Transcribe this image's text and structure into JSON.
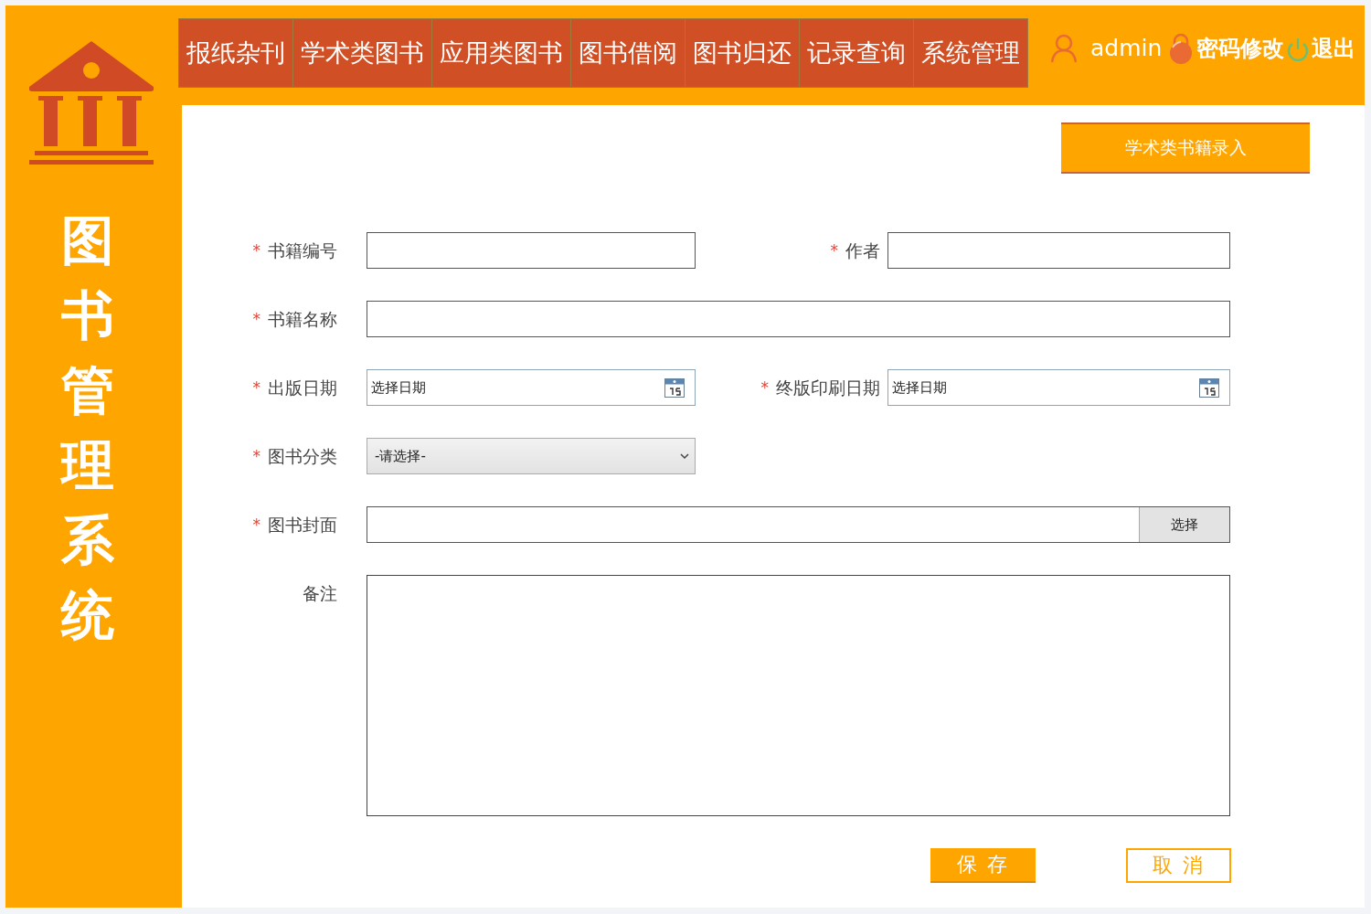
{
  "sidebar": {
    "title": "图书管理系统"
  },
  "nav": {
    "items": [
      {
        "label": "报纸杂刊"
      },
      {
        "label": "学术类图书"
      },
      {
        "label": "应用类图书"
      },
      {
        "label": "图书借阅"
      },
      {
        "label": "图书归还"
      },
      {
        "label": "记录查询"
      },
      {
        "label": "系统管理"
      }
    ]
  },
  "user": {
    "name": "admin",
    "links": [
      {
        "kind": "password",
        "label": "密码修改"
      },
      {
        "kind": "logout",
        "label": "退出"
      }
    ]
  },
  "action_button": "学术类书籍录入",
  "form": {
    "rows": [
      [
        {
          "kind": "text",
          "label": "书籍编号",
          "required_mark": "*"
        },
        {
          "kind": "text",
          "label": "作者",
          "required_mark": "*"
        }
      ],
      [
        {
          "kind": "text",
          "label": "书籍名称",
          "required_mark": "*"
        }
      ],
      [
        {
          "kind": "date",
          "label": "出版日期",
          "required_mark": "*",
          "placeholder": "选择日期"
        },
        {
          "kind": "date",
          "label": "终版印刷日期",
          "required_mark": "*",
          "placeholder": "选择日期"
        }
      ],
      [
        {
          "kind": "select",
          "label": "图书分类",
          "required_mark": "*",
          "value": "-请选择-"
        }
      ],
      [
        {
          "kind": "file",
          "label": "图书封面",
          "required_mark": "*",
          "button": "选择"
        }
      ],
      [
        {
          "kind": "textarea",
          "label": "备注"
        }
      ]
    ],
    "buttons": [
      {
        "kind": "primary",
        "label": "保 存"
      },
      {
        "kind": "secondary",
        "label": "取 消"
      }
    ]
  }
}
